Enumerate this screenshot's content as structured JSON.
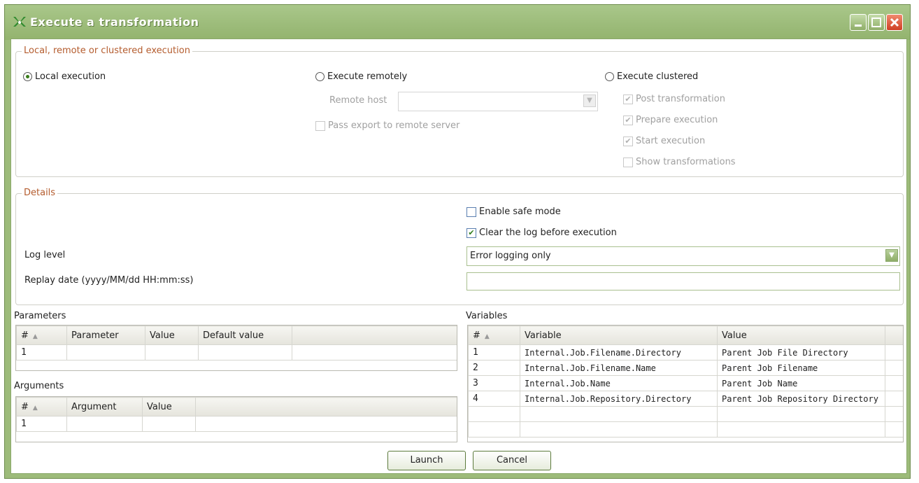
{
  "window": {
    "title": "Execute a transformation"
  },
  "execution_group": {
    "legend": "Local, remote or clustered execution",
    "local_label": "Local execution",
    "remote_label": "Execute remotely",
    "clustered_label": "Execute clustered",
    "remote_host_label": "Remote host",
    "remote_host_value": "",
    "pass_export_label": "Pass export to remote server",
    "post_transformation_label": "Post transformation",
    "prepare_execution_label": "Prepare execution",
    "start_execution_label": "Start execution",
    "show_transformations_label": "Show transformations"
  },
  "details_group": {
    "legend": "Details",
    "safe_mode_label": "Enable safe mode",
    "clear_log_label": "Clear the log before execution",
    "log_level_label": "Log level",
    "log_level_value": "Error logging only",
    "replay_date_label": "Replay date (yyyy/MM/dd HH:mm:ss)",
    "replay_date_value": ""
  },
  "parameters": {
    "title": "Parameters",
    "columns": [
      "#",
      "Parameter",
      "Value",
      "Default value"
    ],
    "rows": [
      [
        "1",
        "",
        "",
        ""
      ]
    ]
  },
  "arguments": {
    "title": "Arguments",
    "columns": [
      "#",
      "Argument",
      "Value"
    ],
    "rows": [
      [
        "1",
        "",
        ""
      ]
    ]
  },
  "variables": {
    "title": "Variables",
    "columns": [
      "#",
      "Variable",
      "Value"
    ],
    "rows": [
      [
        "1",
        "Internal.Job.Filename.Directory",
        "Parent Job File Directory"
      ],
      [
        "2",
        "Internal.Job.Filename.Name",
        "Parent Job Filename"
      ],
      [
        "3",
        "Internal.Job.Name",
        "Parent Job Name"
      ],
      [
        "4",
        "Internal.Job.Repository.Directory",
        "Parent Job Repository Directory"
      ]
    ]
  },
  "buttons": {
    "launch": "Launch",
    "cancel": "Cancel"
  }
}
